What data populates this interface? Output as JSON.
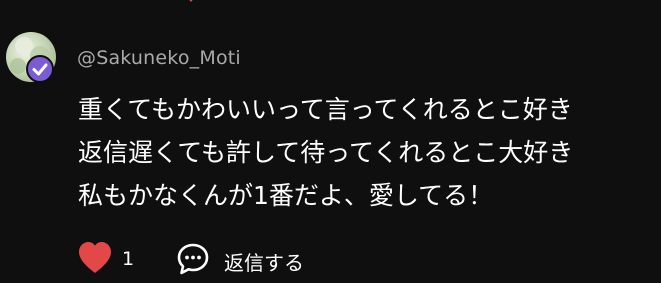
{
  "comment": {
    "username": "@Sakuneko_Moti",
    "lines": [
      "重くてもかわいいって言ってくれるとこ好き",
      "返信遅くても許して待ってくれるとこ大好き",
      "私もかなくんが1番だよ、愛してる！"
    ],
    "like_count": "1",
    "reply_label": "返信する",
    "verified": true
  },
  "icons": {
    "like": "heart-icon",
    "reply": "speech-bubble-icon",
    "verified": "verified-badge-icon"
  },
  "colors": {
    "background": "#0f0f0f",
    "heart": "#e34848",
    "username": "#aaaaaa",
    "verified": "#7b5cd6"
  }
}
